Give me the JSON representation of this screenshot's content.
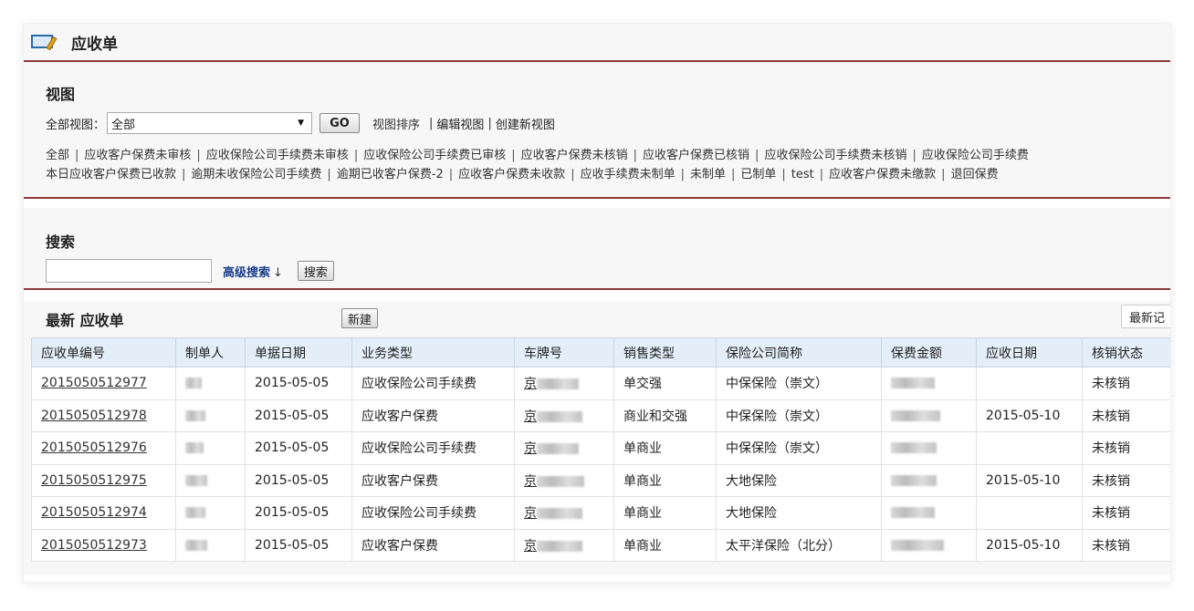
{
  "title": "应收单",
  "view": {
    "heading": "视图",
    "label": "全部视图：",
    "selected": "全部",
    "go": "GO",
    "links": [
      "视图排序",
      "编辑视图",
      "创建新视图"
    ],
    "filters_line1": [
      "全部",
      "应收客户保费未审核",
      "应收保险公司手续费未审核",
      "应收保险公司手续费已审核",
      "应收客户保费未核销",
      "应收客户保费已核销",
      "应收保险公司手续费未核销",
      "应收保险公司手续费"
    ],
    "filters_line2": [
      "本日应收客户保费已收款",
      "逾期未收保险公司手续费",
      "逾期已收客户保费-2",
      "应收客户保费未收款",
      "应收手续费未制单",
      "未制单",
      "已制单",
      "test",
      "应收客户保费未缴款",
      "退回保费"
    ]
  },
  "search": {
    "heading": "搜索",
    "input_value": "",
    "advanced": "高级搜索",
    "advanced_arrow": "↓",
    "button": "搜索"
  },
  "list": {
    "title": "最新 应收单",
    "new_button": "新建",
    "latest_button": "最新记",
    "columns": [
      "应收单编号",
      "制单人",
      "单据日期",
      "业务类型",
      "车牌号",
      "销售类型",
      "保险公司简称",
      "保费金额",
      "应收日期",
      "核销状态"
    ],
    "rows": [
      {
        "id": "2015050512977",
        "date": "2015-05-05",
        "biz": "应收保险公司手续费",
        "plate": "京",
        "sale": "单交强",
        "company": "中保保险（崇文）",
        "due": "",
        "status": "未核销"
      },
      {
        "id": "2015050512978",
        "date": "2015-05-05",
        "biz": "应收客户保费",
        "plate": "京",
        "sale": "商业和交强",
        "company": "中保保险（崇文）",
        "due": "2015-05-10",
        "status": "未核销"
      },
      {
        "id": "2015050512976",
        "date": "2015-05-05",
        "biz": "应收保险公司手续费",
        "plate": "京",
        "sale": "单商业",
        "company": "中保保险（崇文）",
        "due": "",
        "status": "未核销"
      },
      {
        "id": "2015050512975",
        "date": "2015-05-05",
        "biz": "应收客户保费",
        "plate": "京",
        "sale": "单商业",
        "company": "大地保险",
        "due": "2015-05-10",
        "status": "未核销"
      },
      {
        "id": "2015050512974",
        "date": "2015-05-05",
        "biz": "应收保险公司手续费",
        "plate": "京",
        "sale": "单商业",
        "company": "大地保险",
        "due": "",
        "status": "未核销"
      },
      {
        "id": "2015050512973",
        "date": "2015-05-05",
        "biz": "应收客户保费",
        "plate": "京",
        "sale": "单商业",
        "company": "太平洋保险（北分）",
        "due": "2015-05-10",
        "status": "未核销"
      }
    ]
  },
  "colors": {
    "accent_line": "#8c3a3a",
    "link": "#1a3d8a",
    "header_bg": "#e3eef8"
  }
}
